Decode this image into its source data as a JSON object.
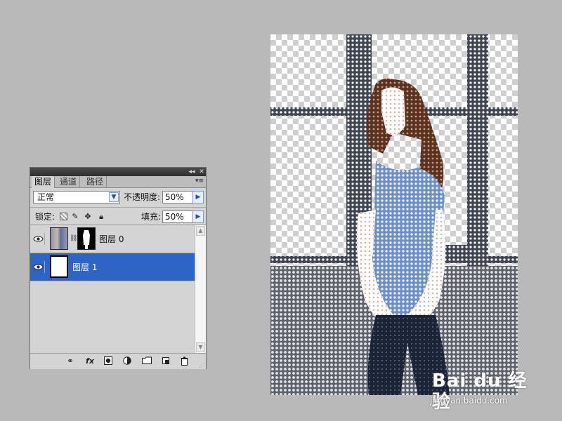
{
  "panel": {
    "tabs": [
      "图层",
      "通道",
      "路径"
    ],
    "active_tab": 0,
    "blend_mode": "正常",
    "opacity_label": "不透明度:",
    "opacity_value": "50%",
    "lock_label": "锁定:",
    "fill_label": "填充:",
    "fill_value": "50%",
    "layers": [
      {
        "name": "图层 0",
        "selected": false,
        "visible": true,
        "has_mask": true
      },
      {
        "name": "图层 1",
        "selected": true,
        "visible": true,
        "has_mask": false
      }
    ],
    "bottom_icons": [
      "link-icon",
      "fx-icon",
      "mask-icon",
      "adjustment-icon",
      "group-folder-icon",
      "new-layer-icon",
      "trash-icon"
    ],
    "fx_label": "fx"
  },
  "canvas": {
    "description_icon": "halftone-photo"
  },
  "watermark": {
    "logo": "Bai du 经验",
    "url": "jingyan.baidu.com"
  },
  "colors": {
    "background": "#b9b9b9",
    "selection": "#2e64c6",
    "panel": "#d4d4d4"
  }
}
